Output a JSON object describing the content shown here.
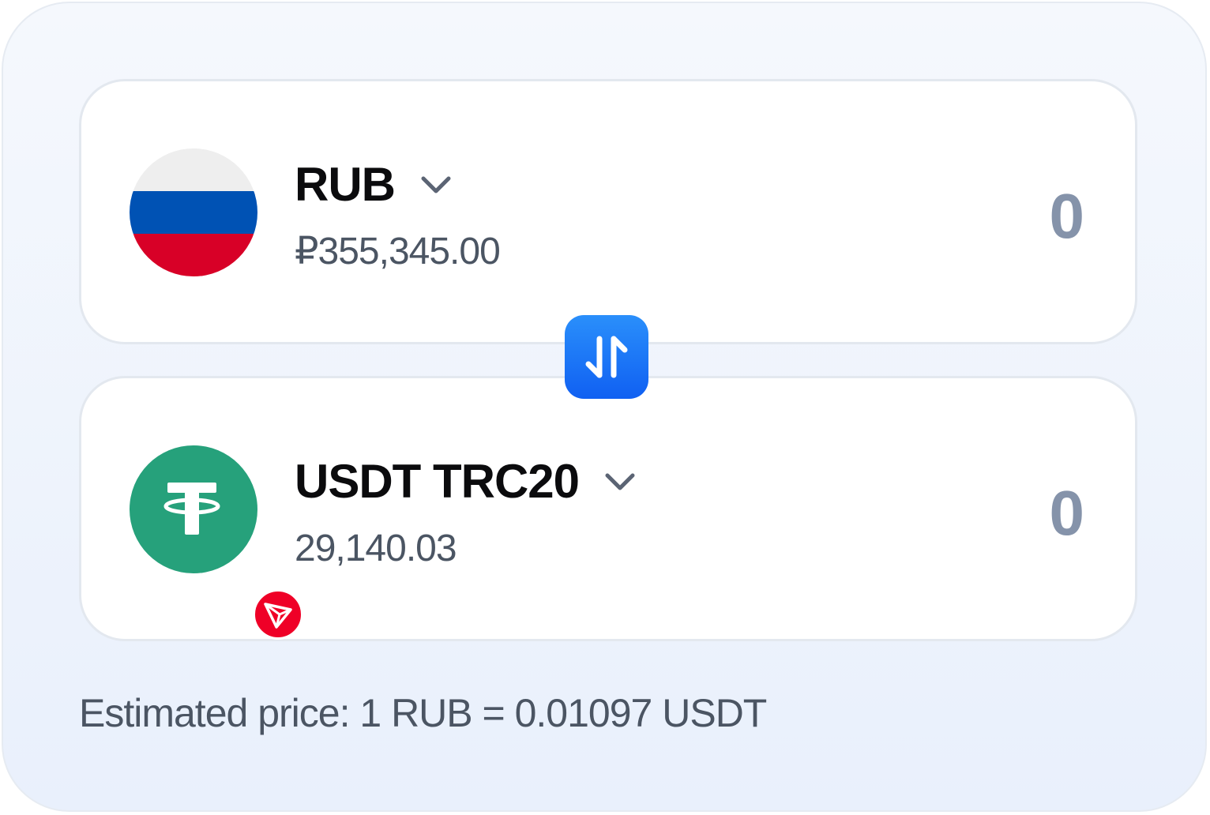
{
  "from": {
    "symbol": "RUB",
    "balance": "₽355,345.00",
    "amount_placeholder": "0",
    "icon": "russia-flag-icon"
  },
  "to": {
    "symbol": "USDT TRC20",
    "balance": "29,140.03",
    "amount_placeholder": "0",
    "icon": "tether-icon",
    "network_icon": "tron-icon"
  },
  "swap_icon": "swap-arrows-icon",
  "estimated_price": "Estimated price: 1 RUB = 0.01097 USDT",
  "colors": {
    "accent": "#1a73f7",
    "flag_white": "#eeeeee",
    "flag_blue": "#0052b4",
    "flag_red": "#d80027",
    "tether_green": "#26a17b",
    "tron_red": "#ef0027",
    "amount_gray": "#8593aa",
    "secondary_text": "#4b5563"
  }
}
